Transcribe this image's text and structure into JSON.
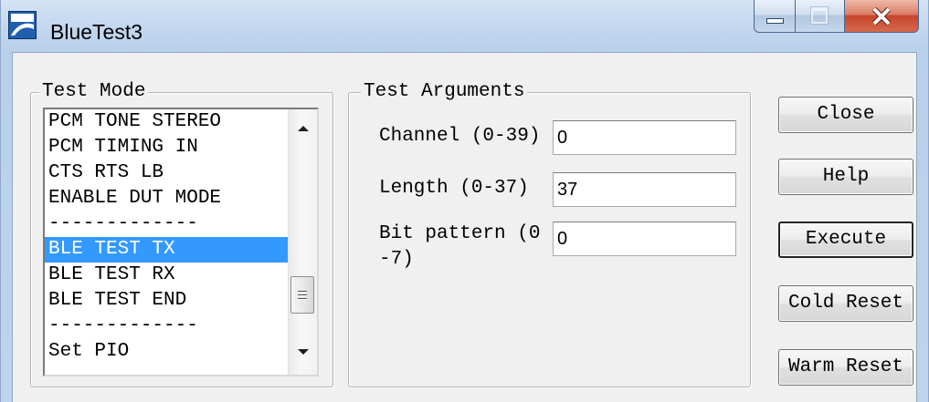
{
  "window": {
    "title": "BlueTest3",
    "icons": {
      "app": "app-icon",
      "minimize": "minimize-icon",
      "maximize": "maximize-icon",
      "close": "close-icon"
    },
    "maximize_enabled": false
  },
  "test_mode": {
    "legend": "Test Mode",
    "items": [
      "PCM TONE STEREO",
      "PCM TIMING IN",
      "CTS RTS LB",
      "ENABLE DUT MODE",
      "-------------",
      "BLE TEST TX",
      "BLE TEST RX",
      "BLE TEST END",
      "-------------",
      "Set PIO"
    ],
    "selected_index": 5,
    "scroll_percent": 82
  },
  "test_arguments": {
    "legend": "Test Arguments",
    "fields": [
      {
        "label": "Channel (0-39)",
        "value": "0"
      },
      {
        "label": "Length (0-37)",
        "value": "37"
      },
      {
        "label": "Bit pattern (0\n-7)",
        "value": "0"
      }
    ]
  },
  "buttons": [
    {
      "label": "Close"
    },
    {
      "label": "Help"
    },
    {
      "label": "Execute",
      "default": true
    },
    {
      "label": "Cold Reset"
    },
    {
      "label": "Warm Reset"
    }
  ],
  "colors": {
    "selection": "#3399ff",
    "client_background": "#f0f0f0",
    "frame": "#c4d8ef",
    "close_button": "#c7452c"
  }
}
